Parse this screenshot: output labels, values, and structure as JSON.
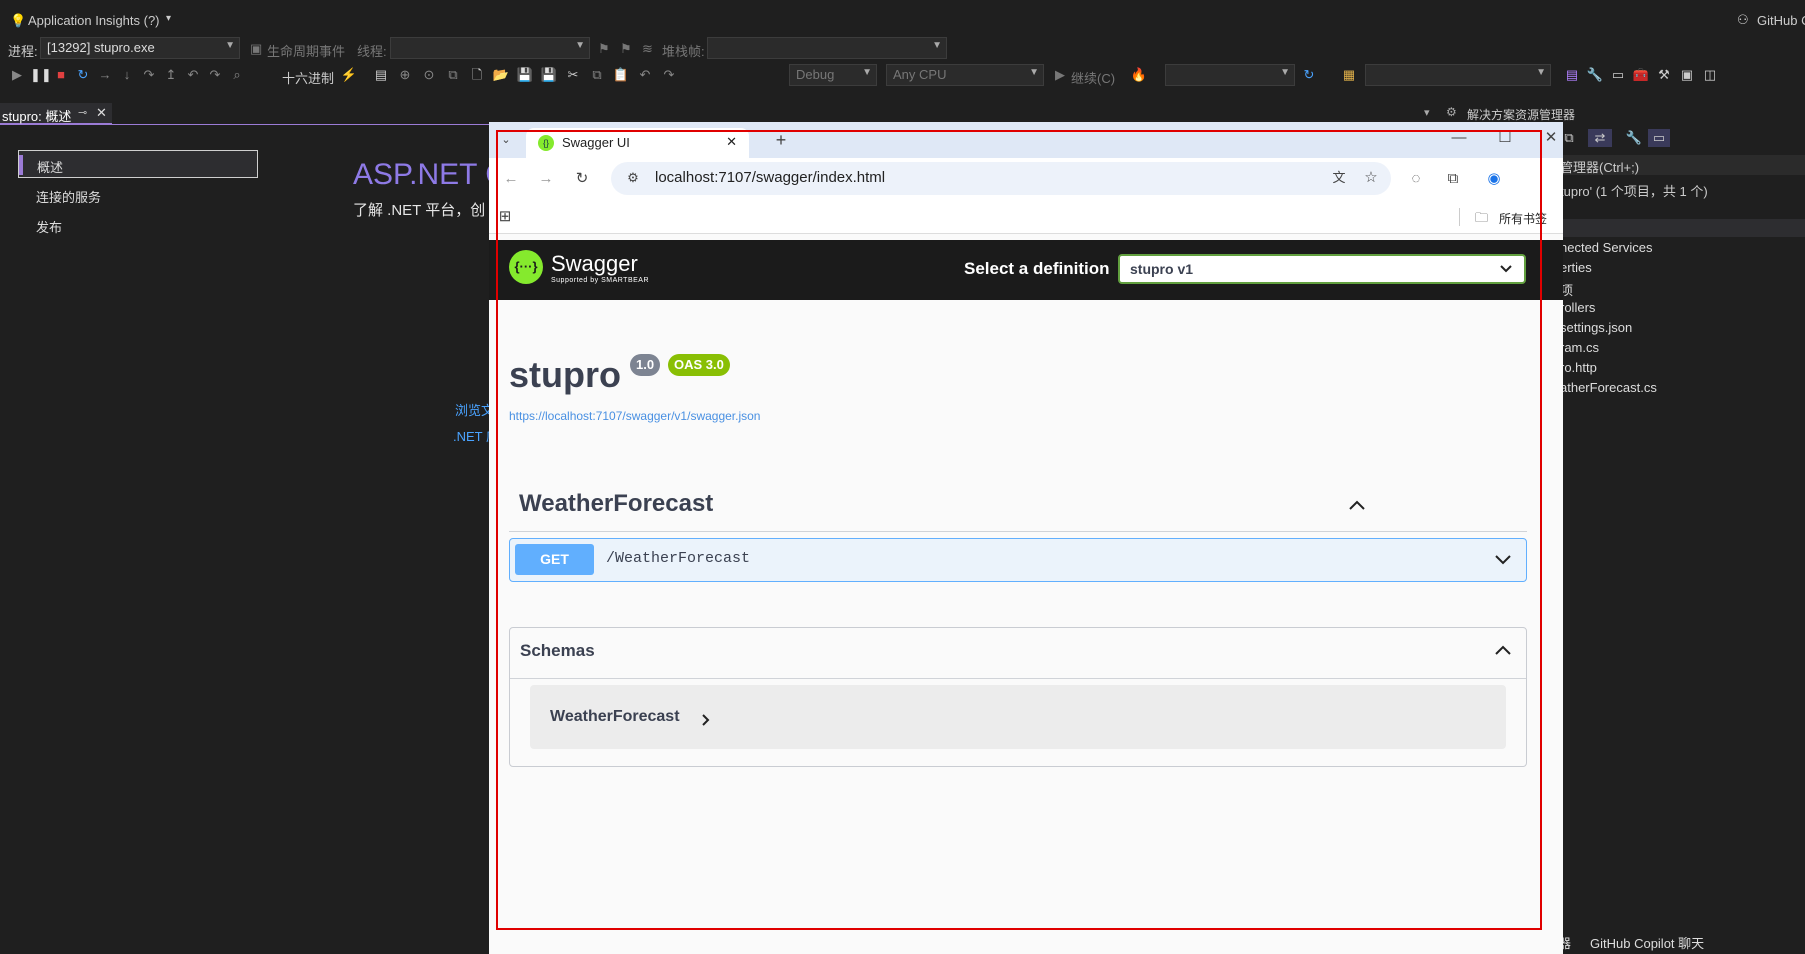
{
  "vs": {
    "app_insights": "Application Insights (?)",
    "github": "GitHub C",
    "process_label": "进程:",
    "process_value": "[13292] stupro.exe",
    "lifecycle": "生命周期事件",
    "thread_label": "线程:",
    "stack_label": "堆栈帧:",
    "hex": "十六进制",
    "config": "Debug",
    "platform": "Any CPU",
    "continue": "继续(C)",
    "doc_tab": "stupro: 概述",
    "left_nav": [
      "概述",
      "连接的服务",
      "发布"
    ],
    "asp_title": "ASP.NET C",
    "learn_text": "了解 .NET 平台，创",
    "link1": "浏览文",
    "link2": ".NET 应",
    "solution_explorer": "解决方案资源管理器",
    "se_search": "管理器(Ctrl+;)",
    "se_solution": "tupro' (1 个项目，共 1 个)",
    "se_items": [
      "nected Services",
      "erties",
      "项",
      "rollers",
      "settings.json",
      "ram.cs",
      "ro.http",
      "atherForecast.cs"
    ],
    "status_left": "器",
    "status_right": "GitHub Copilot 聊天"
  },
  "browser": {
    "tab_title": "Swagger UI",
    "url": "localhost:7107/swagger/index.html",
    "bookmarks_label": "所有书签"
  },
  "swagger": {
    "brand": "Swagger",
    "supported_by": "Supported by SMARTBEAR",
    "definition_label": "Select a definition",
    "definition_value": "stupro v1",
    "api_title": "stupro",
    "version": "1.0",
    "oas": "OAS 3.0",
    "spec_url": "https://localhost:7107/swagger/v1/swagger.json",
    "tag": "WeatherForecast",
    "operation": {
      "method": "GET",
      "path": "/WeatherForecast"
    },
    "schemas_title": "Schemas",
    "model_name": "WeatherForecast"
  },
  "colors": {
    "accent": "#9b7bd6",
    "get": "#61affe",
    "swagger_green": "#85ea2d",
    "frame": "#e00000"
  }
}
